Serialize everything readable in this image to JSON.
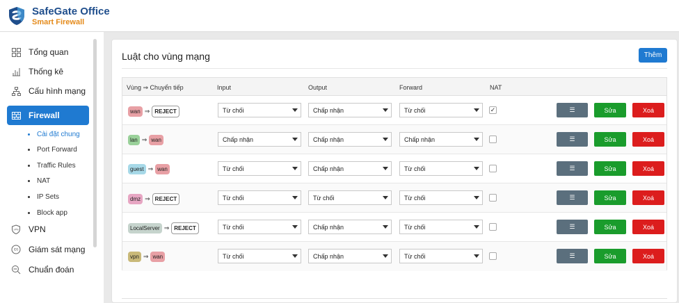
{
  "brand": {
    "title": "SafeGate Office",
    "subtitle": "Smart Firewall"
  },
  "sidebar": {
    "items": [
      {
        "label": "Tổng quan",
        "icon": "grid-icon"
      },
      {
        "label": "Thống kê",
        "icon": "bar-chart-icon"
      },
      {
        "label": "Cấu hình mạng",
        "icon": "network-icon"
      },
      {
        "label": "Firewall",
        "icon": "firewall-icon"
      },
      {
        "label": "VPN",
        "icon": "vpn-shield-icon"
      },
      {
        "label": "Giám sát mạng",
        "icon": "ids-icon"
      },
      {
        "label": "Chuẩn đoán",
        "icon": "diagnose-icon"
      }
    ],
    "firewall_sub": [
      "Cài đặt chung",
      "Port Forward",
      "Traffic Rules",
      "NAT",
      "IP Sets",
      "Block app"
    ]
  },
  "page": {
    "title": "Luật cho vùng mạng",
    "add_label": "Thêm"
  },
  "table": {
    "headers": {
      "zone": "Vùng ⇒ Chuyển tiếp",
      "input": "Input",
      "output": "Output",
      "forward": "Forward",
      "nat": "NAT"
    },
    "rows": [
      {
        "zone": "wan",
        "target": "REJECT",
        "input": "Từ chối",
        "output": "Chấp nhận",
        "forward": "Từ chối",
        "nat": true
      },
      {
        "zone": "lan",
        "target": "wan",
        "input": "Chấp nhận",
        "output": "Chấp nhận",
        "forward": "Chấp nhận",
        "nat": false
      },
      {
        "zone": "guest",
        "target": "wan",
        "input": "Từ chối",
        "output": "Chấp nhận",
        "forward": "Từ chối",
        "nat": false
      },
      {
        "zone": "dmz",
        "target": "REJECT",
        "input": "Từ chối",
        "output": "Từ chối",
        "forward": "Từ chối",
        "nat": false
      },
      {
        "zone": "LocalServer",
        "target": "REJECT",
        "input": "Từ chối",
        "output": "Chấp nhận",
        "forward": "Từ chối",
        "nat": false
      },
      {
        "zone": "vpn",
        "target": "wan",
        "input": "Từ chối",
        "output": "Chấp nhận",
        "forward": "Từ chối",
        "nat": false
      }
    ],
    "actions": {
      "menu": "☰",
      "edit": "Sửa",
      "delete": "Xoá"
    },
    "nat_check_mark": "✓"
  },
  "colors": {
    "accent": "#1f7ad1",
    "edit": "#1a9c2c",
    "delete": "#dc1d1d",
    "menu": "#5b6f7d"
  }
}
